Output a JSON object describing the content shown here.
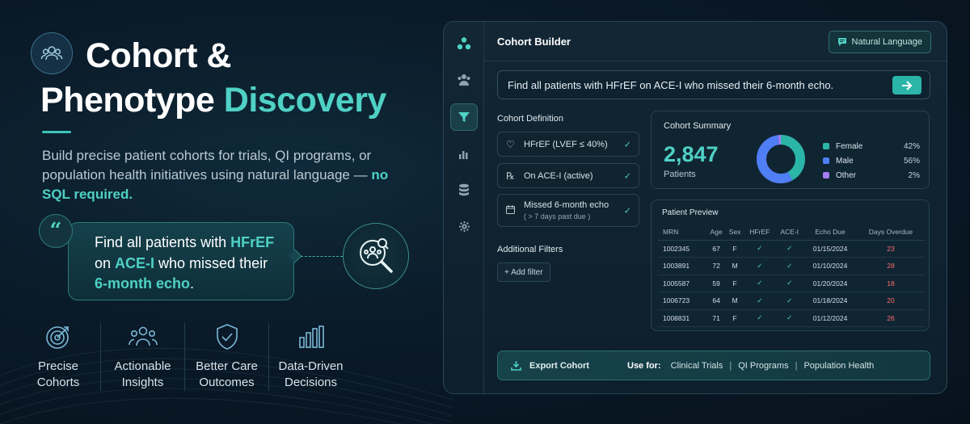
{
  "hero": {
    "title_line1": "Cohort &",
    "title_line2_plain": "Phenotype ",
    "title_line2_accent": "Discovery",
    "subtitle": "Build precise patient cohorts for trials, QI programs, or population health initiatives using natural language —",
    "subtitle_highlight": "no SQL required."
  },
  "quote": {
    "mark": "“",
    "p1": "Find all patients with ",
    "h1": "HFrEF",
    "p2": " on ",
    "h2": "ACE-I",
    "p3": "  who missed their ",
    "h3": "6-month echo",
    "p4": "."
  },
  "features": [
    {
      "label": "Precise Cohorts",
      "icon": "target-icon"
    },
    {
      "label": "Actionable Insights",
      "icon": "people-icon"
    },
    {
      "label": "Better Care Outcomes",
      "icon": "shield-check-icon"
    },
    {
      "label": "Data-Driven Decisions",
      "icon": "bar-chart-icon"
    }
  ],
  "app": {
    "title": "Cohort Builder",
    "nl_button": "Natural Language",
    "query": "Find all patients with HFrEF on ACE-I who missed their 6-month echo.",
    "sidebar_icons": [
      "logo-icon",
      "users-icon",
      "filter-icon",
      "bar-chart-icon",
      "database-icon",
      "settings-icon"
    ],
    "cohort_definition": {
      "title": "Cohort Definition",
      "criteria": [
        {
          "label": "HFrEF (LVEF ≤ 40%)",
          "sub": "",
          "icon": "heart-icon"
        },
        {
          "label": "On ACE-I (active)",
          "sub": "",
          "icon": "rx-icon"
        },
        {
          "label": "Missed 6-month echo",
          "sub": "( > 7 days past due )",
          "icon": "calendar-icon"
        }
      ]
    },
    "additional_filters": {
      "title": "Additional Filters",
      "add_label": "+ Add filter"
    },
    "summary": {
      "title": "Cohort Summary",
      "count": "2,847",
      "count_label": "Patients",
      "legend": [
        {
          "label": "Female",
          "pct": "42%",
          "value": 42,
          "color": "#2bb5a8"
        },
        {
          "label": "Male",
          "pct": "56%",
          "value": 56,
          "color": "#4f7ef5"
        },
        {
          "label": "Other",
          "pct": "2%",
          "value": 2,
          "color": "#a57cf2"
        }
      ]
    },
    "preview": {
      "title": "Patient Preview",
      "columns": [
        "MRN",
        "Age",
        "Sex",
        "HFrEF",
        "ACE-I",
        "Echo Due",
        "Days Overdue"
      ],
      "rows": [
        [
          "1002345",
          "67",
          "F",
          "✓",
          "✓",
          "01/15/2024",
          "23"
        ],
        [
          "1003891",
          "72",
          "M",
          "✓",
          "✓",
          "01/10/2024",
          "28"
        ],
        [
          "1005587",
          "59",
          "F",
          "✓",
          "✓",
          "01/20/2024",
          "18"
        ],
        [
          "1006723",
          "64",
          "M",
          "✓",
          "✓",
          "01/18/2024",
          "20"
        ],
        [
          "1008831",
          "71",
          "F",
          "✓",
          "✓",
          "01/12/2024",
          "26"
        ]
      ]
    },
    "export": {
      "button": "Export Cohort",
      "use_for_label": "Use for:",
      "uses": [
        "Clinical Trials",
        "QI Programs",
        "Population Health"
      ]
    }
  }
}
